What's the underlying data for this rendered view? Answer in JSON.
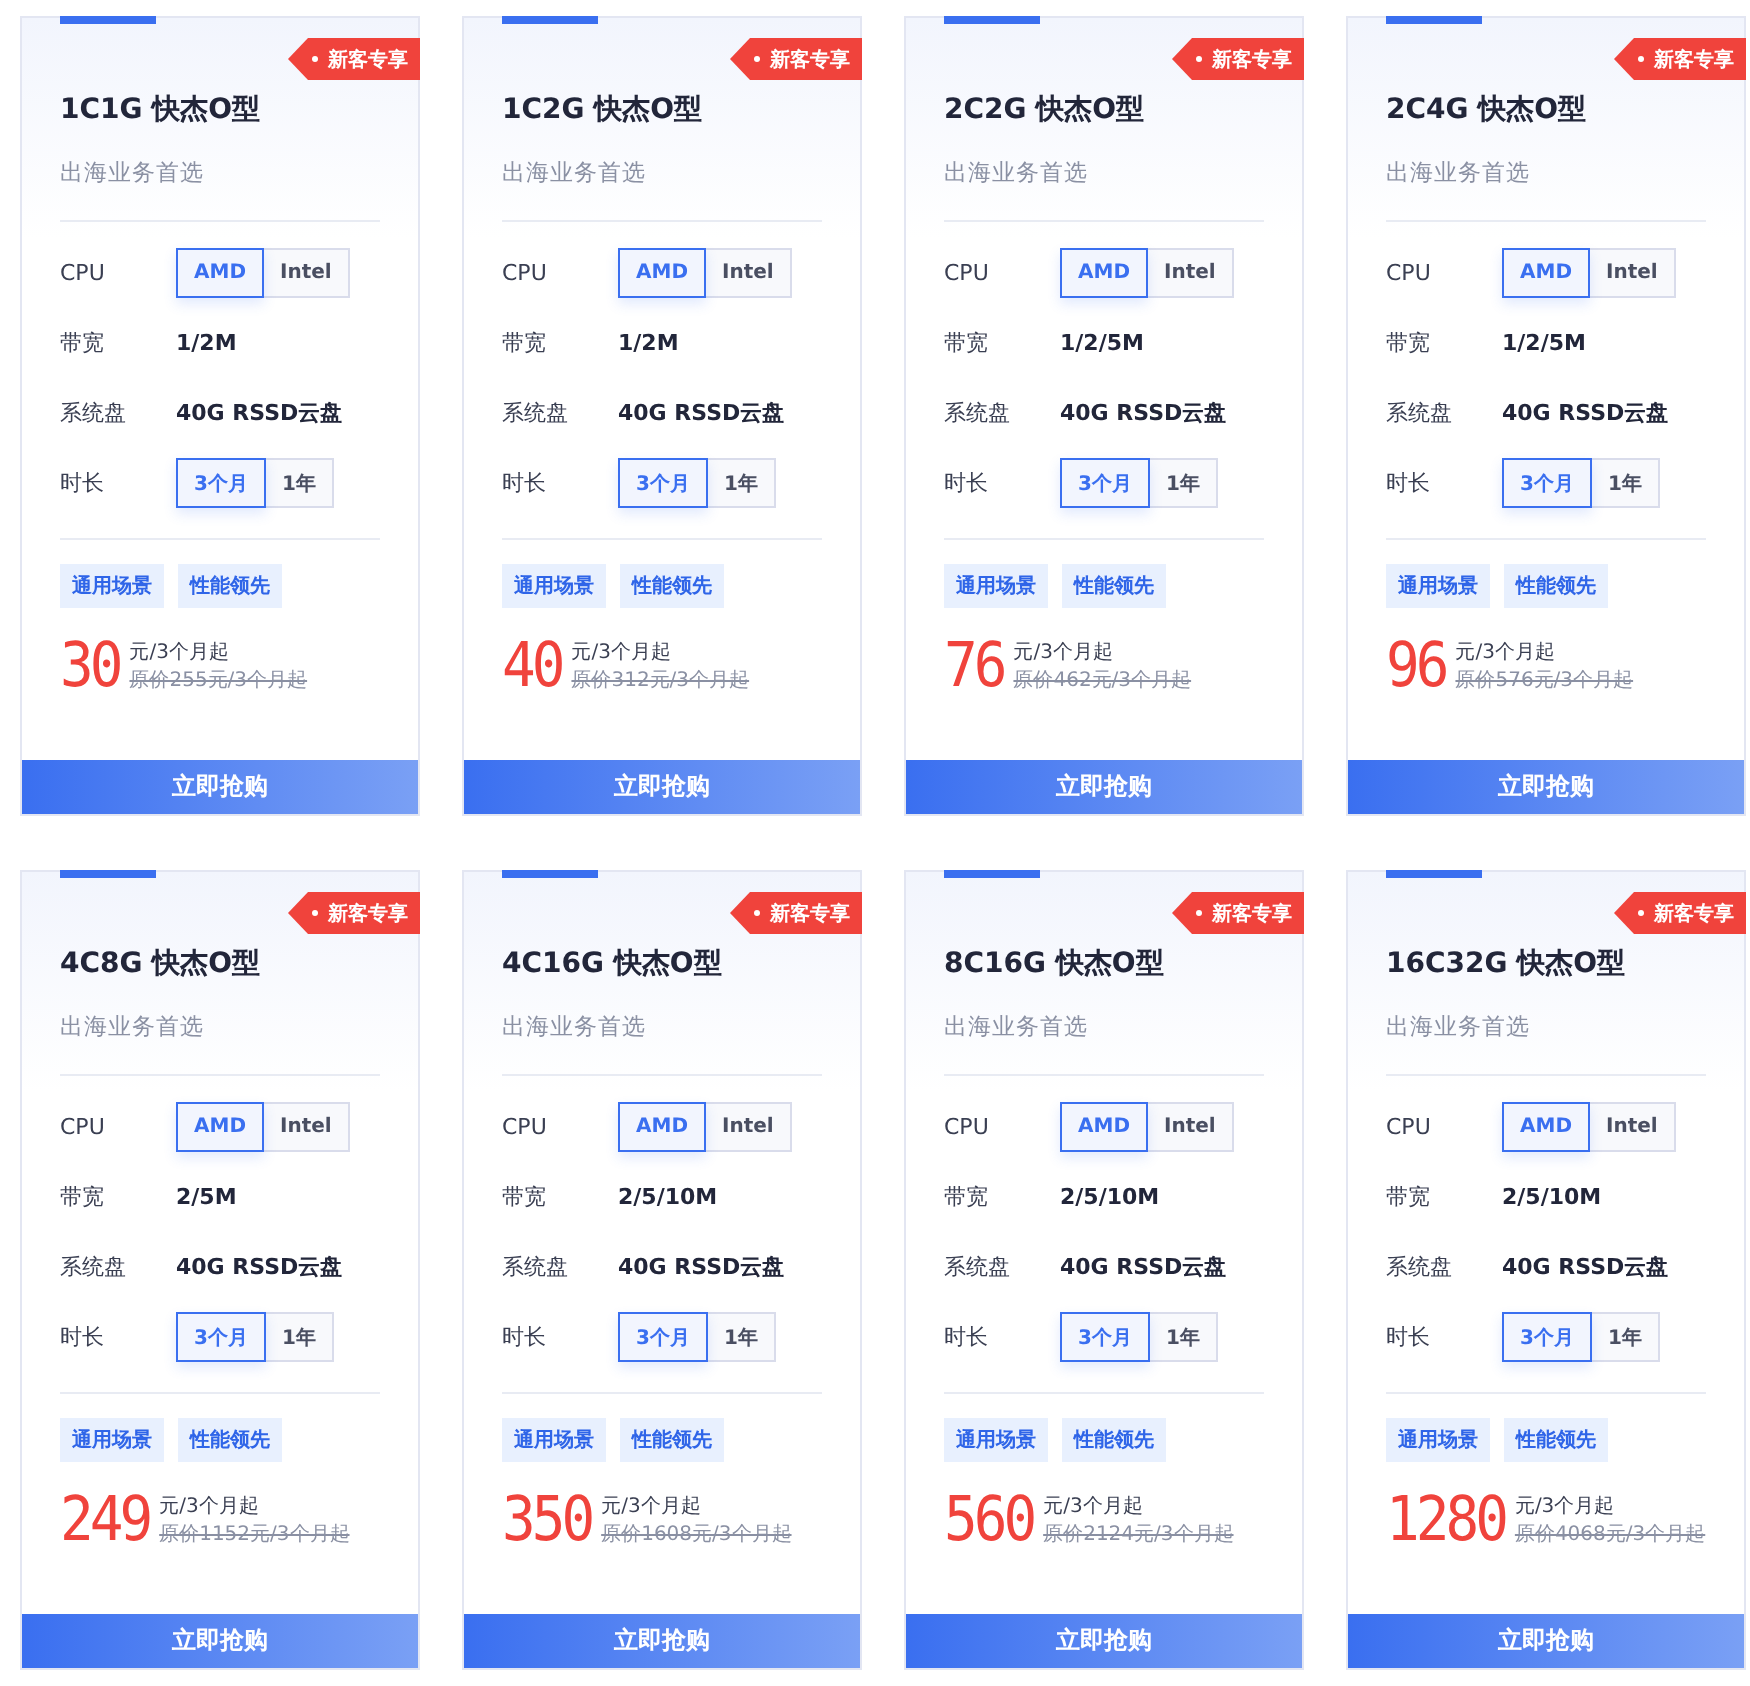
{
  "cards": [
    {
      "badge": "新客专享",
      "title": "1C1G 快杰O型",
      "subtitle": "出海业务首选",
      "rows": [
        {
          "kind": "options",
          "label": "CPU",
          "options": [
            {
              "label": "AMD",
              "selected": true
            },
            {
              "label": "Intel",
              "selected": false
            }
          ]
        },
        {
          "kind": "text",
          "label": "带宽",
          "value": "1/2M"
        },
        {
          "kind": "text",
          "label": "系统盘",
          "value": "40G RSSD云盘"
        },
        {
          "kind": "options",
          "label": "时长",
          "options": [
            {
              "label": "3个月",
              "selected": true
            },
            {
              "label": "1年",
              "selected": false
            }
          ]
        }
      ],
      "tags": [
        "通用场景",
        "性能领先"
      ],
      "price": "30",
      "unit": "元/3个月起",
      "original": "原价255元/3个月起",
      "button": "立即抢购"
    },
    {
      "badge": "新客专享",
      "title": "1C2G 快杰O型",
      "subtitle": "出海业务首选",
      "rows": [
        {
          "kind": "options",
          "label": "CPU",
          "options": [
            {
              "label": "AMD",
              "selected": true
            },
            {
              "label": "Intel",
              "selected": false
            }
          ]
        },
        {
          "kind": "text",
          "label": "带宽",
          "value": "1/2M"
        },
        {
          "kind": "text",
          "label": "系统盘",
          "value": "40G RSSD云盘"
        },
        {
          "kind": "options",
          "label": "时长",
          "options": [
            {
              "label": "3个月",
              "selected": true
            },
            {
              "label": "1年",
              "selected": false
            }
          ]
        }
      ],
      "tags": [
        "通用场景",
        "性能领先"
      ],
      "price": "40",
      "unit": "元/3个月起",
      "original": "原价312元/3个月起",
      "button": "立即抢购"
    },
    {
      "badge": "新客专享",
      "title": "2C2G 快杰O型",
      "subtitle": "出海业务首选",
      "rows": [
        {
          "kind": "options",
          "label": "CPU",
          "options": [
            {
              "label": "AMD",
              "selected": true
            },
            {
              "label": "Intel",
              "selected": false
            }
          ]
        },
        {
          "kind": "text",
          "label": "带宽",
          "value": "1/2/5M"
        },
        {
          "kind": "text",
          "label": "系统盘",
          "value": "40G RSSD云盘"
        },
        {
          "kind": "options",
          "label": "时长",
          "options": [
            {
              "label": "3个月",
              "selected": true
            },
            {
              "label": "1年",
              "selected": false
            }
          ]
        }
      ],
      "tags": [
        "通用场景",
        "性能领先"
      ],
      "price": "76",
      "unit": "元/3个月起",
      "original": "原价462元/3个月起",
      "button": "立即抢购"
    },
    {
      "badge": "新客专享",
      "title": "2C4G 快杰O型",
      "subtitle": "出海业务首选",
      "rows": [
        {
          "kind": "options",
          "label": "CPU",
          "options": [
            {
              "label": "AMD",
              "selected": true
            },
            {
              "label": "Intel",
              "selected": false
            }
          ]
        },
        {
          "kind": "text",
          "label": "带宽",
          "value": "1/2/5M"
        },
        {
          "kind": "text",
          "label": "系统盘",
          "value": "40G RSSD云盘"
        },
        {
          "kind": "options",
          "label": "时长",
          "options": [
            {
              "label": "3个月",
              "selected": true
            },
            {
              "label": "1年",
              "selected": false
            }
          ]
        }
      ],
      "tags": [
        "通用场景",
        "性能领先"
      ],
      "price": "96",
      "unit": "元/3个月起",
      "original": "原价576元/3个月起",
      "button": "立即抢购"
    },
    {
      "badge": "新客专享",
      "title": "4C8G 快杰O型",
      "subtitle": "出海业务首选",
      "rows": [
        {
          "kind": "options",
          "label": "CPU",
          "options": [
            {
              "label": "AMD",
              "selected": true
            },
            {
              "label": "Intel",
              "selected": false
            }
          ]
        },
        {
          "kind": "text",
          "label": "带宽",
          "value": "2/5M"
        },
        {
          "kind": "text",
          "label": "系统盘",
          "value": "40G RSSD云盘"
        },
        {
          "kind": "options",
          "label": "时长",
          "options": [
            {
              "label": "3个月",
              "selected": true
            },
            {
              "label": "1年",
              "selected": false
            }
          ]
        }
      ],
      "tags": [
        "通用场景",
        "性能领先"
      ],
      "price": "249",
      "unit": "元/3个月起",
      "original": "原价1152元/3个月起",
      "button": "立即抢购"
    },
    {
      "badge": "新客专享",
      "title": "4C16G 快杰O型",
      "subtitle": "出海业务首选",
      "rows": [
        {
          "kind": "options",
          "label": "CPU",
          "options": [
            {
              "label": "AMD",
              "selected": true
            },
            {
              "label": "Intel",
              "selected": false
            }
          ]
        },
        {
          "kind": "text",
          "label": "带宽",
          "value": "2/5/10M"
        },
        {
          "kind": "text",
          "label": "系统盘",
          "value": "40G RSSD云盘"
        },
        {
          "kind": "options",
          "label": "时长",
          "options": [
            {
              "label": "3个月",
              "selected": true
            },
            {
              "label": "1年",
              "selected": false
            }
          ]
        }
      ],
      "tags": [
        "通用场景",
        "性能领先"
      ],
      "price": "350",
      "unit": "元/3个月起",
      "original": "原价1608元/3个月起",
      "button": "立即抢购"
    },
    {
      "badge": "新客专享",
      "title": "8C16G 快杰O型",
      "subtitle": "出海业务首选",
      "rows": [
        {
          "kind": "options",
          "label": "CPU",
          "options": [
            {
              "label": "AMD",
              "selected": true
            },
            {
              "label": "Intel",
              "selected": false
            }
          ]
        },
        {
          "kind": "text",
          "label": "带宽",
          "value": "2/5/10M"
        },
        {
          "kind": "text",
          "label": "系统盘",
          "value": "40G RSSD云盘"
        },
        {
          "kind": "options",
          "label": "时长",
          "options": [
            {
              "label": "3个月",
              "selected": true
            },
            {
              "label": "1年",
              "selected": false
            }
          ]
        }
      ],
      "tags": [
        "通用场景",
        "性能领先"
      ],
      "price": "560",
      "unit": "元/3个月起",
      "original": "原价2124元/3个月起",
      "button": "立即抢购"
    },
    {
      "badge": "新客专享",
      "title": "16C32G 快杰O型",
      "subtitle": "出海业务首选",
      "rows": [
        {
          "kind": "options",
          "label": "CPU",
          "options": [
            {
              "label": "AMD",
              "selected": true
            },
            {
              "label": "Intel",
              "selected": false
            }
          ]
        },
        {
          "kind": "text",
          "label": "带宽",
          "value": "2/5/10M"
        },
        {
          "kind": "text",
          "label": "系统盘",
          "value": "40G RSSD云盘"
        },
        {
          "kind": "options",
          "label": "时长",
          "options": [
            {
              "label": "3个月",
              "selected": true
            },
            {
              "label": "1年",
              "selected": false
            }
          ]
        }
      ],
      "tags": [
        "通用场景",
        "性能领先"
      ],
      "price": "1280",
      "unit": "元/3个月起",
      "original": "原价4068元/3个月起",
      "button": "立即抢购"
    }
  ]
}
